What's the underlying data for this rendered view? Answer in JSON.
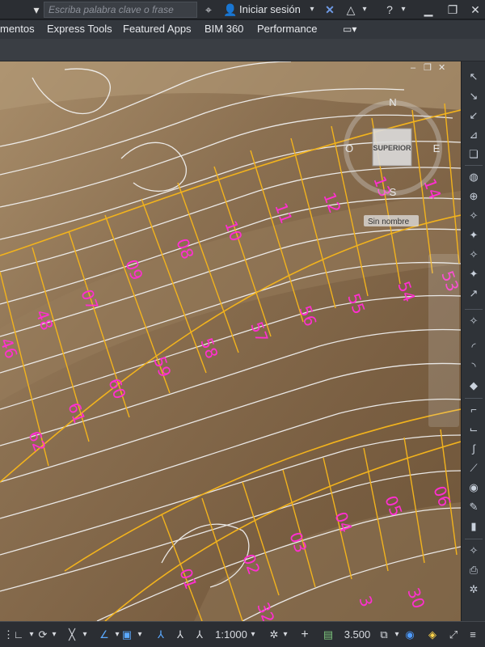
{
  "app": {
    "search_placeholder": "Escriba palabra clave o frase",
    "login_label": "Iniciar sesión"
  },
  "menu": {
    "items": [
      "mentos",
      "Express Tools",
      "Featured Apps",
      "BIM 360",
      "Performance"
    ]
  },
  "icons": {
    "binoculars": "binoculars-icon",
    "user": "user-icon",
    "exchange": "autodesk-exchange-icon",
    "a360": "a360-icon",
    "help": "help-icon",
    "minimize": "minimize-icon",
    "restore": "restore-icon",
    "close": "close-icon"
  },
  "viewcube": {
    "face_label": "SUPERIOR",
    "north": "N",
    "south": "S",
    "east": "E",
    "west": "O",
    "ucs_name": "Sin nombre"
  },
  "section_labels": [
    "01",
    "02",
    "03",
    "04",
    "05",
    "06",
    "07",
    "08",
    "09",
    "10",
    "11",
    "12",
    "13",
    "14",
    "3",
    "30",
    "32",
    "46",
    "48",
    "54",
    "55",
    "56",
    "57",
    "58",
    "59",
    "60",
    "61",
    "62",
    "53"
  ],
  "status": {
    "scale": "1:1000",
    "elevation": "3.500"
  },
  "colors": {
    "contour": "#ffffff",
    "section_line": "#f2b31d",
    "label": "#ff2fd0",
    "terrain": "#8a6d4c"
  }
}
